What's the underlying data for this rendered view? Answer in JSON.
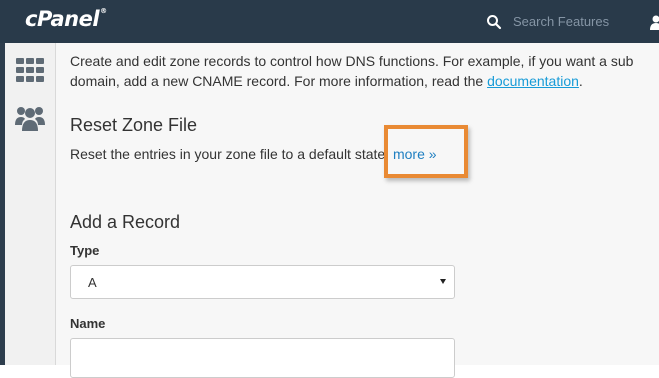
{
  "header": {
    "logo": "cPanel",
    "logo_mark": "®",
    "search": {
      "placeholder": "Search Features",
      "icon": "search-icon"
    },
    "user_icon": "user-icon",
    "background_color": "#293a4a"
  },
  "sidebar": {
    "items": [
      {
        "icon": "grid-apps-icon"
      },
      {
        "icon": "users-group-icon"
      }
    ]
  },
  "intro": {
    "line1": "Create and edit zone records to control how DNS functions. For example, if you want a sub",
    "line2_prefix": "domain, add a new CNAME record. For more information, read the ",
    "link_text": "documentation",
    "line2_suffix": "."
  },
  "reset_zone": {
    "title": "Reset Zone File",
    "description": "Reset the entries in your zone file to a default state.",
    "more_link": "more »"
  },
  "highlight": {
    "color": "#e98a34"
  },
  "add_record": {
    "title": "Add a Record",
    "type_label": "Type",
    "type_value": "A",
    "name_label": "Name",
    "name_value": ""
  },
  "colors": {
    "link": "#179bd7",
    "text": "#333333",
    "content_bg": "#f7f7f7"
  }
}
